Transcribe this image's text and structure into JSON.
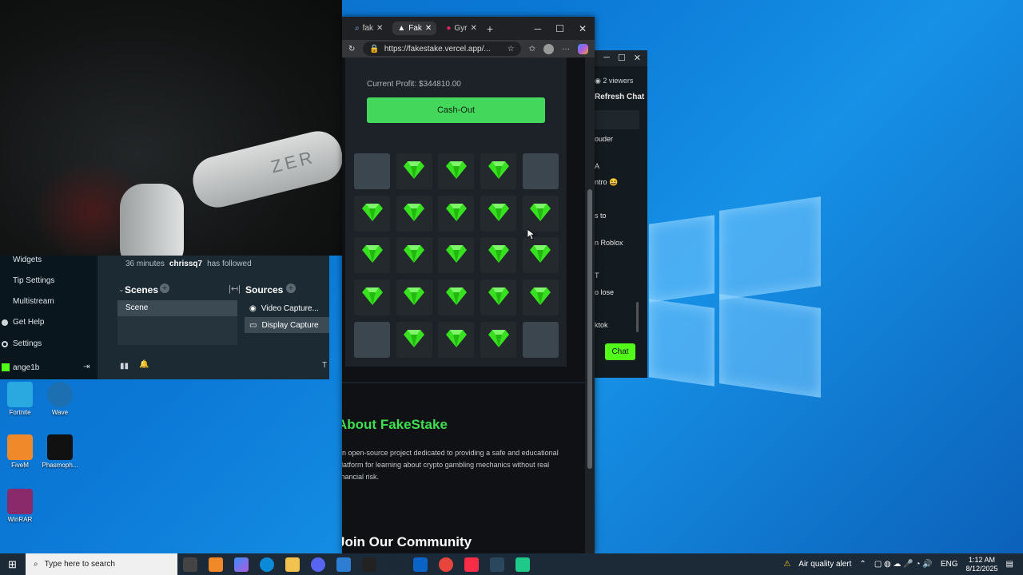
{
  "webcam": {
    "band_text": "ZER"
  },
  "obs": {
    "sidebar": [
      {
        "label": "Widgets"
      },
      {
        "label": "Tip Settings"
      },
      {
        "label": "Multistream"
      },
      {
        "label": "Get Help"
      },
      {
        "label": "Settings"
      }
    ],
    "user": "ange1b",
    "activity": {
      "time": "36 minutes",
      "user": "chrissq7",
      "action": "has followed"
    },
    "scenes_title": "Scenes",
    "scene_item": "Scene",
    "sources_title": "Sources",
    "sources": [
      {
        "label": "Video Capture..."
      },
      {
        "label": "Display Capture"
      }
    ],
    "mini_letter": "T"
  },
  "chat": {
    "viewers": "2 viewers",
    "refresh": "Refresh Chat",
    "lines": [
      "ouder",
      "A",
      "ntro 😆",
      "s to",
      "n Roblox",
      "T",
      "o lose",
      "ktok"
    ],
    "chat_button": "Chat"
  },
  "browser": {
    "tabs": [
      {
        "label": "fak",
        "icon": "search-icon"
      },
      {
        "label": "Fak",
        "icon": "triangle-icon"
      },
      {
        "label": "Gyr",
        "icon": "dot-icon"
      }
    ],
    "new_tab": "+",
    "url": "https://fakestake.vercel.app/...",
    "page": {
      "profit_label": "Current Profit: $344810.00",
      "cashout_label": "Cash-Out",
      "grid": [
        [
          "closed",
          "gem",
          "gem",
          "gem",
          "closed"
        ],
        [
          "gem",
          "gem",
          "gem",
          "gem",
          "gem"
        ],
        [
          "gem",
          "gem",
          "gem",
          "gem",
          "gem"
        ],
        [
          "gem",
          "gem",
          "gem",
          "gem",
          "gem"
        ],
        [
          "closed",
          "gem",
          "gem",
          "gem",
          "closed"
        ]
      ],
      "about_title": "About FakeStake",
      "about_text": "An open-source project dedicated to providing a safe and educational platform for learning about crypto gambling mechanics without real financial risk.",
      "join_title": "Join Our Community"
    }
  },
  "desktop_icons": [
    {
      "label": "Fortnite",
      "color": "#2aa8e0"
    },
    {
      "label": "Wave",
      "color": "#1c6fb0"
    },
    {
      "label": "FiveM",
      "color": "#f0892a"
    },
    {
      "label": "Phasmoph...",
      "color": "#111111"
    },
    {
      "label": "WinRAR",
      "color": "#8a2a6a"
    }
  ],
  "taskbar": {
    "search_placeholder": "Type here to search",
    "alert": "Air quality alert",
    "lang": "ENG",
    "time": "1:12 AM",
    "date": "8/12/2025"
  },
  "colors": {
    "accent_green": "#43d85b",
    "gem_green": "#37e11f",
    "kick_green": "#53fc18"
  }
}
